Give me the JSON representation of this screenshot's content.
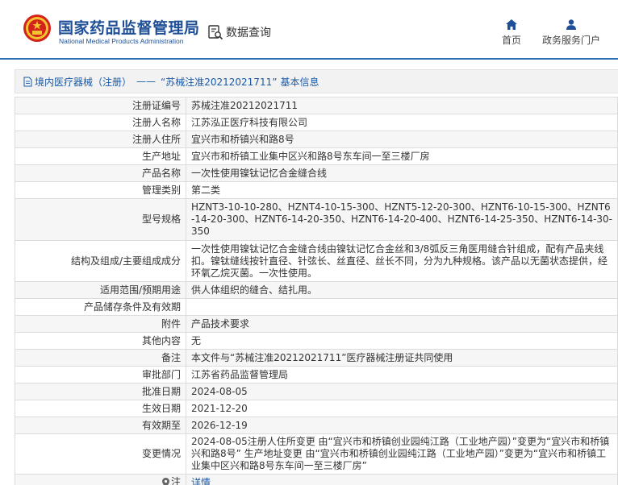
{
  "header": {
    "org_name_cn": "国家药品监督管理局",
    "org_name_en": "National Medical Products Administration",
    "data_query_label": "数据查询",
    "nav": [
      {
        "label": "首页",
        "icon": "home-icon"
      },
      {
        "label": "政务服务门户",
        "icon": "user-icon"
      }
    ]
  },
  "breadcrumb": {
    "category": "境内医疗器械（注册）",
    "separator": "——",
    "record": "“苏械注准20212021711”",
    "suffix": "基本信息"
  },
  "details": {
    "rows": [
      {
        "label": "注册证编号",
        "value": "苏械注准20212021711"
      },
      {
        "label": "注册人名称",
        "value": "江苏泓正医疗科技有限公司"
      },
      {
        "label": "注册人住所",
        "value": "宜兴市和桥镇兴和路8号"
      },
      {
        "label": "生产地址",
        "value": "宜兴市和桥镇工业集中区兴和路8号东车间一至三楼厂房"
      },
      {
        "label": "产品名称",
        "value": "一次性使用镍钛记忆合金缝合线"
      },
      {
        "label": "管理类别",
        "value": "第二类"
      },
      {
        "label": "型号规格",
        "value": "HZNT3-10-10-280、HZNT4-10-15-300、HZNT5-12-20-300、HZNT6-10-15-300、HZNT6-14-20-300、HZNT6-14-20-350、HZNT6-14-20-400、HZNT6-14-25-350、HZNT6-14-30-350"
      },
      {
        "label": "结构及组成/主要组成成分",
        "value": "一次性使用镍钛记忆合金缝合线由镍钛记忆合金丝和3/8弧反三角医用缝合针组成，配有产品夹线扣。镍钛缝线按针直径、针弦长、丝直径、丝长不同，分为九种规格。该产品以无菌状态提供，经环氧乙烷灭菌。一次性使用。"
      },
      {
        "label": "适用范围/预期用途",
        "value": "供人体组织的缝合、结扎用。"
      },
      {
        "label": "产品储存条件及有效期",
        "value": ""
      },
      {
        "label": "附件",
        "value": "产品技术要求"
      },
      {
        "label": "其他内容",
        "value": "无"
      },
      {
        "label": "备注",
        "value": "本文件与“苏械注准20212021711”医疗器械注册证共同使用"
      },
      {
        "label": "审批部门",
        "value": "江苏省药品监督管理局"
      },
      {
        "label": "批准日期",
        "value": "2024-08-05"
      },
      {
        "label": "生效日期",
        "value": "2021-12-20"
      },
      {
        "label": "有效期至",
        "value": "2026-12-19"
      },
      {
        "label": "变更情况",
        "value": "2024-08-05注册人住所变更 由“宜兴市和桥镇创业园纯江路（工业地产园）”变更为“宜兴市和桥镇兴和路8号” 生产地址变更 由“宜兴市和桥镇创业园纯江路（工业地产园）”变更为“宜兴市和桥镇工业集中区兴和路8号东车间一至三楼厂房”"
      }
    ],
    "note_row": {
      "label": "注",
      "link": "详情"
    }
  },
  "colors": {
    "brand_blue": "#1f4f97",
    "link_blue": "#1a5aa6",
    "emblem_red": "#d4231a",
    "emblem_gold": "#f3c331"
  }
}
